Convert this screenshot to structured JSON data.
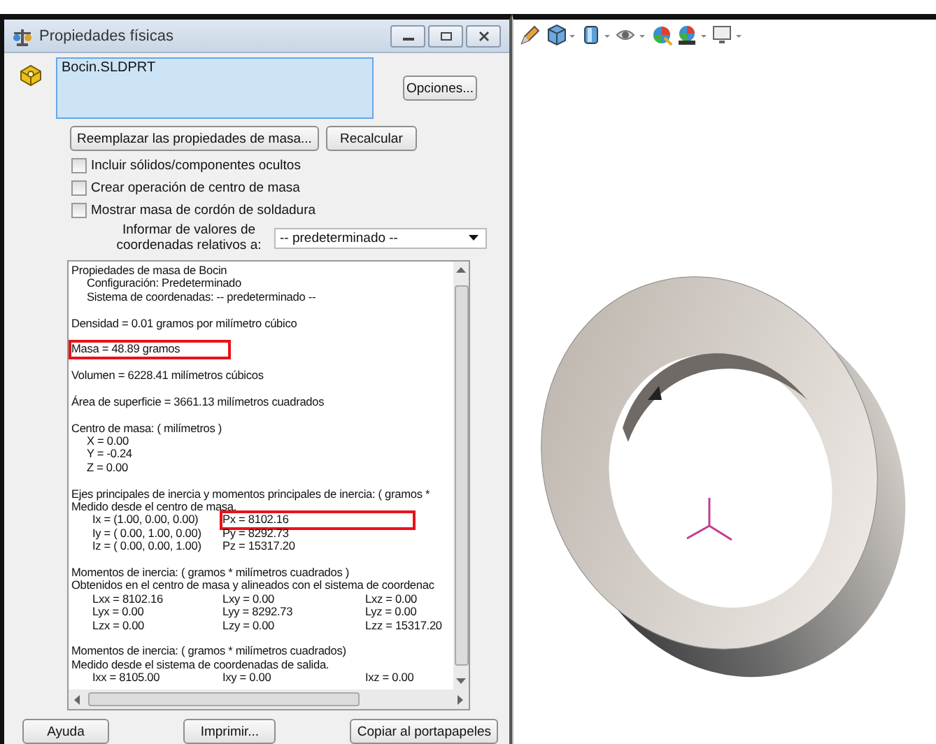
{
  "window": {
    "title": "Propiedades físicas"
  },
  "selection_list": {
    "items": [
      "Bocin.SLDPRT"
    ]
  },
  "options_button": "Opciones...",
  "action_buttons": [
    "Reemplazar las propiedades de masa...",
    "Recalcular"
  ],
  "checkboxes": [
    {
      "label": "Incluir sólidos/componentes ocultos",
      "checked": false
    },
    {
      "label": "Crear operación de centro de masa",
      "checked": false
    },
    {
      "label": "Mostrar masa de cordón de soldadura",
      "checked": false
    }
  ],
  "relative_to": {
    "label": "Informar de valores de coordenadas relativos a:",
    "value": "-- predeterminado --"
  },
  "results": [
    {
      "kind": "line",
      "spaced": false,
      "cells": [
        {
          "text": "Propiedades de masa de Bocin",
          "highlighted": false
        }
      ]
    },
    {
      "kind": "sub",
      "spaced": false,
      "cells": [
        {
          "text": "Configuración:  Predeterminado",
          "highlighted": false
        }
      ]
    },
    {
      "kind": "sub",
      "spaced": false,
      "cells": [
        {
          "text": "Sistema de coordenadas:  -- predeterminado --",
          "highlighted": false
        }
      ]
    },
    {
      "kind": "line",
      "spaced": true,
      "cells": [
        {
          "text": "Densidad = 0.01 gramos por milímetro cúbico",
          "highlighted": false
        }
      ]
    },
    {
      "kind": "line",
      "spaced": true,
      "cells": [
        {
          "text": "Masa = 48.89 gramos",
          "highlighted": true
        }
      ]
    },
    {
      "kind": "line",
      "spaced": true,
      "cells": [
        {
          "text": "Volumen = 6228.41 milímetros cúbicos",
          "highlighted": false
        }
      ]
    },
    {
      "kind": "line",
      "spaced": true,
      "cells": [
        {
          "text": "Área de superficie = 3661.13  milímetros cuadrados",
          "highlighted": false
        }
      ]
    },
    {
      "kind": "line",
      "spaced": true,
      "cells": [
        {
          "text": "Centro de masa: ( milímetros )",
          "highlighted": false
        }
      ]
    },
    {
      "kind": "sub",
      "spaced": false,
      "cells": [
        {
          "text": "X = 0.00",
          "highlighted": false
        }
      ]
    },
    {
      "kind": "sub",
      "spaced": false,
      "cells": [
        {
          "text": "Y = -0.24",
          "highlighted": false
        }
      ]
    },
    {
      "kind": "sub",
      "spaced": false,
      "cells": [
        {
          "text": "Z = 0.00",
          "highlighted": false
        }
      ]
    },
    {
      "kind": "line",
      "spaced": true,
      "cells": [
        {
          "text": "Ejes principales de inercia y momentos principales de inercia: ( gramos *",
          "highlighted": false
        }
      ]
    },
    {
      "kind": "line",
      "spaced": false,
      "cells": [
        {
          "text": "Medido desde el centro de masa.",
          "highlighted": false
        }
      ]
    },
    {
      "kind": "cols",
      "spaced": false,
      "cells": [
        {
          "text": "Ix = (1.00,  0.00,  0.00)",
          "highlighted": false
        },
        {
          "text": "Px = 8102.16",
          "highlighted": true
        }
      ]
    },
    {
      "kind": "cols",
      "spaced": false,
      "cells": [
        {
          "text": "Iy = ( 0.00,  1.00,  0.00)",
          "highlighted": false
        },
        {
          "text": "Py = 8292.73",
          "highlighted": false
        }
      ]
    },
    {
      "kind": "cols",
      "spaced": false,
      "cells": [
        {
          "text": "Iz = ( 0.00,  0.00,  1.00)",
          "highlighted": false
        },
        {
          "text": "Pz = 15317.20",
          "highlighted": false
        }
      ]
    },
    {
      "kind": "line",
      "spaced": true,
      "cells": [
        {
          "text": "Momentos de inercia: ( gramos *  milímetros cuadrados )",
          "highlighted": false
        }
      ]
    },
    {
      "kind": "line",
      "spaced": false,
      "cells": [
        {
          "text": "Obtenidos en el centro de masa y alineados con el sistema de coordenac",
          "highlighted": false
        }
      ]
    },
    {
      "kind": "cols",
      "spaced": false,
      "cells": [
        {
          "text": "Lxx = 8102.16",
          "highlighted": false
        },
        {
          "text": "Lxy = 0.00",
          "highlighted": false
        },
        {
          "text": "Lxz = 0.00",
          "highlighted": false
        }
      ]
    },
    {
      "kind": "cols",
      "spaced": false,
      "cells": [
        {
          "text": "Lyx = 0.00",
          "highlighted": false
        },
        {
          "text": "Lyy = 8292.73",
          "highlighted": false
        },
        {
          "text": "Lyz = 0.00",
          "highlighted": false
        }
      ]
    },
    {
      "kind": "cols",
      "spaced": false,
      "cells": [
        {
          "text": "Lzx = 0.00",
          "highlighted": false
        },
        {
          "text": "Lzy = 0.00",
          "highlighted": false
        },
        {
          "text": "Lzz = 15317.20",
          "highlighted": false
        }
      ]
    },
    {
      "kind": "line",
      "spaced": true,
      "cells": [
        {
          "text": "Momentos de inercia: ( gramos *  milímetros cuadrados)",
          "highlighted": false
        }
      ]
    },
    {
      "kind": "line",
      "spaced": false,
      "cells": [
        {
          "text": "Medido desde el sistema de coordenadas de salida.",
          "highlighted": false
        }
      ]
    },
    {
      "kind": "cols",
      "spaced": false,
      "cells": [
        {
          "text": "Ixx = 8105.00",
          "highlighted": false
        },
        {
          "text": "Ixy = 0.00",
          "highlighted": false
        },
        {
          "text": "Ixz = 0.00",
          "highlighted": false
        }
      ]
    }
  ],
  "footer_buttons": [
    "Ayuda",
    "Imprimir...",
    "Copiar al portapapeles"
  ]
}
